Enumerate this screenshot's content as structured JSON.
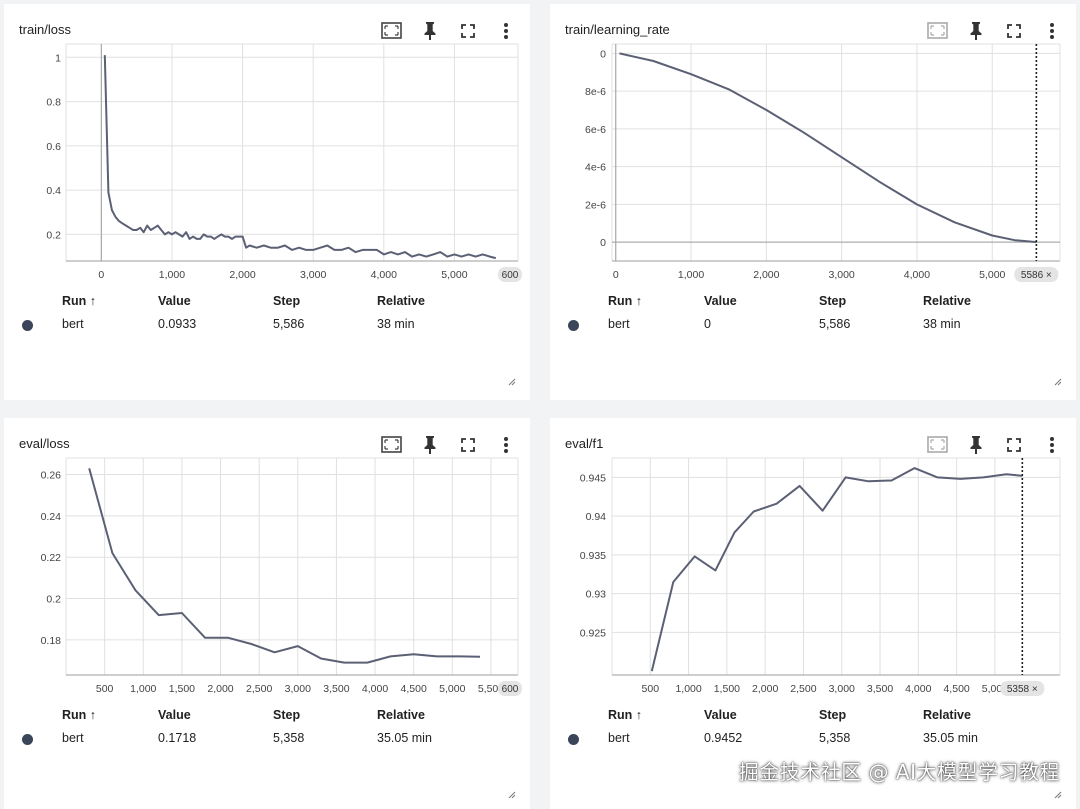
{
  "colors": {
    "line": "#5b6075",
    "dot": "#3a4559",
    "grid": "#e0e0e0",
    "axis": "#9e9e9e"
  },
  "table_headers": {
    "run": "Run ↑",
    "value": "Value",
    "step": "Step",
    "relative": "Relative"
  },
  "icons": [
    "fit-domain-icon",
    "pin-icon",
    "fullscreen-icon",
    "more-vert-icon",
    "resize-handle-icon"
  ],
  "panels": [
    {
      "title": "train/loss",
      "row": {
        "run": "bert",
        "value": "0.0933",
        "step": "5,586",
        "relative": "38 min"
      },
      "x_end_label": "600"
    },
    {
      "title": "train/learning_rate",
      "row": {
        "run": "bert",
        "value": "0",
        "step": "5,586",
        "relative": "38 min"
      },
      "badge": "5586 ×"
    },
    {
      "title": "eval/loss",
      "row": {
        "run": "bert",
        "value": "0.1718",
        "step": "5,358",
        "relative": "35.05 min"
      },
      "x_end_label": "600"
    },
    {
      "title": "eval/f1",
      "row": {
        "run": "bert",
        "value": "0.9452",
        "step": "5,358",
        "relative": "35.05 min"
      },
      "badge": "5358 ×"
    }
  ],
  "chart_data": [
    {
      "type": "line",
      "title": "train/loss",
      "xlim": [
        -500,
        5900
      ],
      "ylim": [
        0.08,
        1.06
      ],
      "xticks": [
        0,
        1000,
        2000,
        3000,
        4000,
        5000
      ],
      "xtick_labels": [
        "0",
        "1,000",
        "2,000",
        "3,000",
        "4,000",
        "5,000"
      ],
      "yticks": [
        0.2,
        0.4,
        0.6,
        0.8,
        1
      ],
      "ytick_labels": [
        "0.2",
        "0.4",
        "0.6",
        "0.8",
        "1"
      ],
      "series": [
        {
          "name": "bert",
          "x": [
            50,
            100,
            150,
            200,
            250,
            300,
            350,
            400,
            450,
            500,
            550,
            600,
            650,
            700,
            750,
            800,
            850,
            900,
            950,
            1000,
            1050,
            1100,
            1150,
            1200,
            1250,
            1300,
            1350,
            1400,
            1450,
            1500,
            1550,
            1600,
            1650,
            1700,
            1750,
            1800,
            1850,
            1900,
            1950,
            2000,
            2050,
            2100,
            2200,
            2300,
            2400,
            2500,
            2600,
            2700,
            2800,
            2900,
            3000,
            3100,
            3200,
            3300,
            3400,
            3500,
            3600,
            3700,
            3800,
            3900,
            4000,
            4100,
            4200,
            4300,
            4400,
            4500,
            4600,
            4700,
            4800,
            4900,
            5000,
            5100,
            5200,
            5300,
            5400,
            5500,
            5586
          ],
          "y": [
            1.01,
            0.39,
            0.31,
            0.28,
            0.26,
            0.25,
            0.24,
            0.23,
            0.22,
            0.22,
            0.23,
            0.21,
            0.24,
            0.22,
            0.23,
            0.24,
            0.22,
            0.2,
            0.21,
            0.2,
            0.21,
            0.2,
            0.19,
            0.21,
            0.18,
            0.19,
            0.18,
            0.18,
            0.2,
            0.19,
            0.19,
            0.18,
            0.19,
            0.2,
            0.19,
            0.19,
            0.18,
            0.19,
            0.19,
            0.19,
            0.14,
            0.15,
            0.14,
            0.15,
            0.14,
            0.14,
            0.15,
            0.13,
            0.14,
            0.13,
            0.13,
            0.14,
            0.15,
            0.13,
            0.13,
            0.14,
            0.12,
            0.13,
            0.13,
            0.13,
            0.11,
            0.12,
            0.11,
            0.12,
            0.1,
            0.11,
            0.1,
            0.11,
            0.12,
            0.1,
            0.11,
            0.1,
            0.11,
            0.1,
            0.11,
            0.1,
            0.0933
          ]
        }
      ]
    },
    {
      "type": "line",
      "title": "train/learning_rate",
      "xlim": [
        -50,
        5900
      ],
      "ylim": [
        -1e-06,
        1.05e-05
      ],
      "xticks": [
        0,
        1000,
        2000,
        3000,
        4000,
        5000
      ],
      "xtick_labels": [
        "0",
        "1,000",
        "2,000",
        "3,000",
        "4,000",
        "5,000"
      ],
      "yticks": [
        0,
        2e-06,
        4e-06,
        6e-06,
        8e-06,
        1e-05
      ],
      "ytick_labels": [
        "0",
        "2e-6",
        "4e-6",
        "6e-6",
        "8e-6",
        "0"
      ],
      "cursor_x": 5586,
      "series": [
        {
          "name": "bert",
          "x": [
            50,
            500,
            1000,
            1500,
            2000,
            2500,
            3000,
            3500,
            4000,
            4500,
            5000,
            5300,
            5586
          ],
          "y": [
            1e-05,
            9.6e-06,
            8.9e-06,
            8.1e-06,
            7e-06,
            5.8e-06,
            4.5e-06,
            3.2e-06,
            2e-06,
            1.05e-06,
            3.5e-07,
            1e-07,
            0
          ]
        }
      ]
    },
    {
      "type": "line",
      "title": "eval/loss",
      "xlim": [
        0,
        5850
      ],
      "ylim": [
        0.163,
        0.268
      ],
      "xticks": [
        500,
        1000,
        1500,
        2000,
        2500,
        3000,
        3500,
        4000,
        4500,
        5000,
        5500
      ],
      "xtick_labels": [
        "500",
        "1,000",
        "1,500",
        "2,000",
        "2,500",
        "3,000",
        "3,500",
        "4,000",
        "4,500",
        "5,000",
        "5,500"
      ],
      "yticks": [
        0.18,
        0.2,
        0.22,
        0.24,
        0.26
      ],
      "ytick_labels": [
        "0.18",
        "0.2",
        "0.22",
        "0.24",
        "0.26"
      ],
      "series": [
        {
          "name": "bert",
          "x": [
            300,
            600,
            900,
            1200,
            1500,
            1800,
            2100,
            2400,
            2700,
            3000,
            3300,
            3600,
            3900,
            4200,
            4500,
            4800,
            5100,
            5358
          ],
          "y": [
            0.263,
            0.222,
            0.204,
            0.192,
            0.193,
            0.181,
            0.181,
            0.178,
            0.174,
            0.177,
            0.171,
            0.169,
            0.169,
            0.172,
            0.173,
            0.172,
            0.172,
            0.1718
          ]
        }
      ]
    },
    {
      "type": "line",
      "title": "eval/f1",
      "xlim": [
        0,
        5850
      ],
      "ylim": [
        0.9195,
        0.9475
      ],
      "xticks": [
        500,
        1000,
        1500,
        2000,
        2500,
        3000,
        3500,
        4000,
        4500,
        5000
      ],
      "xtick_labels": [
        "500",
        "1,000",
        "1,500",
        "2,000",
        "2,500",
        "3,000",
        "3,500",
        "4,000",
        "4,500",
        "5,000"
      ],
      "yticks": [
        0.925,
        0.93,
        0.935,
        0.94,
        0.945
      ],
      "ytick_labels": [
        "0.925",
        "0.93",
        "0.935",
        "0.94",
        "0.945"
      ],
      "cursor_x": 5358,
      "series": [
        {
          "name": "bert",
          "x": [
            520,
            800,
            1080,
            1350,
            1600,
            1850,
            2150,
            2450,
            2750,
            3050,
            3350,
            3650,
            3950,
            4250,
            4550,
            4850,
            5150,
            5358
          ],
          "y": [
            0.92,
            0.9315,
            0.9348,
            0.933,
            0.9379,
            0.9406,
            0.9416,
            0.9439,
            0.9407,
            0.945,
            0.9445,
            0.9446,
            0.9462,
            0.945,
            0.9448,
            0.945,
            0.9454,
            0.9452
          ]
        }
      ]
    }
  ],
  "watermark": "掘金技术社区 @ AI大模型学习教程"
}
